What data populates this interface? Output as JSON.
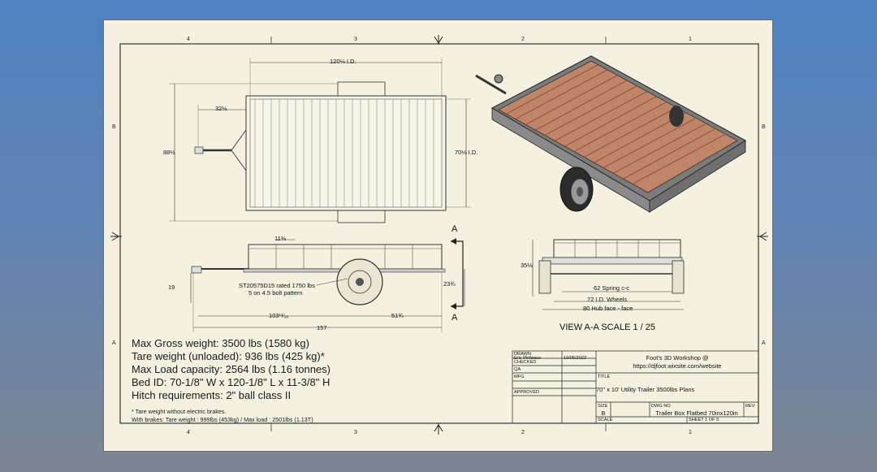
{
  "zones": {
    "top": [
      "4",
      "3",
      "2",
      "1"
    ],
    "bottom": [
      "4",
      "3",
      "2",
      "1"
    ],
    "left": [
      "B",
      "A"
    ],
    "right": [
      "B",
      "A"
    ]
  },
  "dimensions": {
    "overall_length_id": "120⅛ I.D.",
    "tongue_offset": "32½",
    "overall_width": "88½",
    "width_id": "70⅛ I.D.",
    "side_height": "11⅜",
    "hitch_height": "19",
    "axle_note_1": "ST20575D15 rated 1750 lbs",
    "axle_note_2": "5 on 4.5 bolt pattern",
    "deck_height": "23¾",
    "axle_position": "103¹¹⁄₁₆",
    "axle_to_rear": "51¾",
    "overall_length": "157",
    "end_height": "35⅛",
    "spring_cc": "62 Spring c-c",
    "wheels_id": "72 I.D. Wheels",
    "hub_face": "80 Hub face - face",
    "section_marker": "A"
  },
  "view_label": "VIEW A-A SCALE 1 / 25",
  "specs": {
    "max_gross": "Max Gross weight:  3500 lbs (1580 kg)",
    "tare": "Tare weight (unloaded): 936 lbs (425 kg)*",
    "max_load": "Max Load capacity: 2564 lbs (1.16 tonnes)",
    "bed_id": "Bed ID: 70-1/8\" W x 120-1/8\" L x 11-3/8\" H",
    "hitch": "Hitch requirements: 2\" ball class II",
    "footnote_1": "* Tare weight without electric brakes.",
    "footnote_2": "With brakes: Tare weight : 999lbs (453kg) / Max load : 2501lbs (1.13T)"
  },
  "title_block": {
    "drawn_label": "DRAWN",
    "drawn_by": "Eric Pinfeaux",
    "drawn_date": "19/05/2022",
    "checked_label": "CHECKED",
    "qa_label": "QA",
    "mfg_label": "MFG",
    "approved_label": "APPROVED",
    "company": "Foot's 3D Workshop @",
    "website": "https://djfoot.wixsite.com/website",
    "title_label": "TITLE",
    "title": "70\" x 10' Utility Trailer 3500lbs Plans",
    "size_label": "SIZE",
    "size": "B",
    "dwg_label": "DWG NO",
    "dwg_no": "Trailer Box Flatbed 70inx120in",
    "rev_label": "REV",
    "scale_label": "SCALE",
    "sheet": "SHEET 1  OF 5"
  },
  "colors": {
    "background_top": "#4f82c0",
    "paper": "#f4f1e1",
    "deck_wood": "#c08466",
    "frame": "#8c8c8c"
  }
}
